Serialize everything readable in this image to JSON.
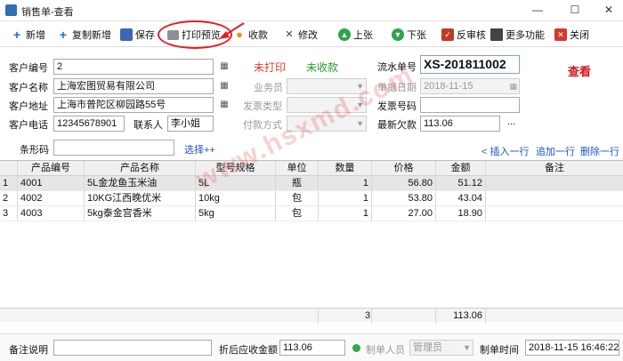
{
  "window": {
    "title": "销售单-查看",
    "minimize": "—",
    "maximize": "☐",
    "close": "✕"
  },
  "toolbar": {
    "add": "新增",
    "copy_add": "复制新增",
    "save": "保存",
    "print_preview": "打印预览",
    "receive": "收款",
    "modify": "修改",
    "prev": "上张",
    "next": "下张",
    "reverse_audit": "反审核",
    "more": "更多功能",
    "close": "关闭"
  },
  "form": {
    "customer_code_label": "客户编号",
    "customer_code": "2",
    "customer_name_label": "客户名称",
    "customer_name": "上海宏图贸易有限公司",
    "customer_address_label": "客户地址",
    "customer_address": "上海市普陀区柳园路55号",
    "customer_phone_label": "客户电话",
    "customer_phone": "12345678901",
    "contact_label": "联系人",
    "contact": "李小姐",
    "print_status": "未打印",
    "receive_status": "未收款",
    "salesperson_label": "业务员",
    "invoice_type_label": "发票类型",
    "payment_method_label": "付款方式",
    "serial_no_label": "流水单号",
    "serial_no": "XS-201811002",
    "doc_date_label": "单据日期",
    "doc_date": "2018-11-15",
    "invoice_no_label": "发票号码",
    "latest_debt_label": "最新欠款",
    "latest_debt": "113.06",
    "ellipsis": "...",
    "page_mode": "查看",
    "barcode_label": "条形码",
    "select_more": "选择++"
  },
  "grid_actions": {
    "insert_row": "< 插入一行",
    "append_row": "追加一行",
    "delete_row": "删除一行"
  },
  "grid": {
    "columns": [
      "产品编号",
      "产品名称",
      "型号规格",
      "单位",
      "数量",
      "价格",
      "金额",
      "备注"
    ],
    "rows": [
      {
        "no": "1",
        "code": "4001",
        "name": "5L金龙鱼玉米油",
        "spec": "5L",
        "unit": "瓶",
        "qty": "1",
        "price": "56.80",
        "amount": "51.12",
        "remark": ""
      },
      {
        "no": "2",
        "code": "4002",
        "name": "10KG江西晚优米",
        "spec": "10kg",
        "unit": "包",
        "qty": "1",
        "price": "53.80",
        "amount": "43.04",
        "remark": ""
      },
      {
        "no": "3",
        "code": "4003",
        "name": "5kg泰金宫香米",
        "spec": "5kg",
        "unit": "包",
        "qty": "1",
        "price": "27.00",
        "amount": "18.90",
        "remark": ""
      }
    ],
    "total_qty": "3",
    "total_amount": "113.06"
  },
  "watermark": "www.hsxmd.com",
  "footer": {
    "remark_label": "备注说明",
    "discount_label": "折后应收金额",
    "discount_amount": "113.06",
    "creator_label": "制单人员",
    "creator": "管理员",
    "create_time_label": "制单时间",
    "create_time": "2018-11-15 16:46:22"
  },
  "colors": {
    "accent_blue": "#1c55c4",
    "status_red": "#e23b23",
    "status_green": "#2a9d2a",
    "annotation_red": "#e02020"
  }
}
